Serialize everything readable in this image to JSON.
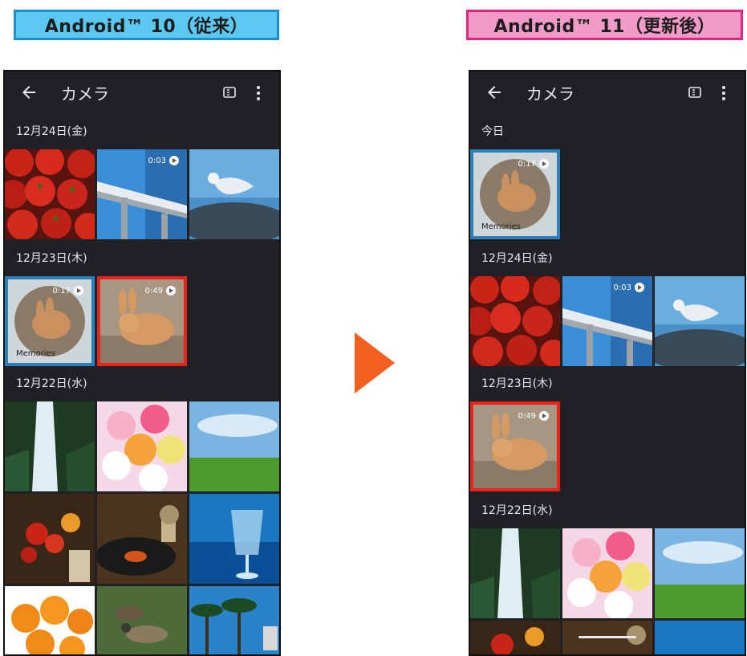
{
  "badges": {
    "old": "Android™ 10（従来）",
    "new": "Android™ 11（更新後）"
  },
  "arrow_color": "#f0601e",
  "phone_old": {
    "app_title": "カメラ",
    "sections": [
      "12月24日(金)",
      "12月23日(木)",
      "12月22日(水)"
    ],
    "durations": {
      "tram": "0:03",
      "memories": "0:17",
      "rabbit": "0:49"
    },
    "memories_label": "Memories"
  },
  "phone_new": {
    "app_title": "カメラ",
    "sections": [
      "今日",
      "12月24日(金)",
      "12月23日(木)",
      "12月22日(水)"
    ],
    "durations": {
      "memories": "0:17",
      "tram": "0:03",
      "rabbit": "0:49"
    },
    "memories_label": "Memories"
  },
  "colors": {
    "highlight_blue": "#2c7fb8",
    "highlight_red": "#e8221c",
    "phone_bg": "#202124"
  }
}
